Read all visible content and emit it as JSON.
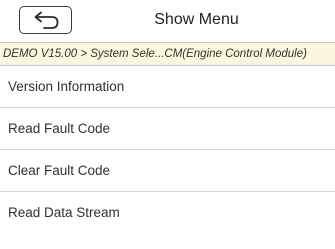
{
  "header": {
    "back_icon": "back-arrow-icon",
    "title": "Show Menu"
  },
  "breadcrumb": {
    "text": "DEMO V15.00 > System Sele...CM(Engine Control Module)"
  },
  "menu": {
    "items": [
      {
        "label": "Version Information"
      },
      {
        "label": "Read Fault Code"
      },
      {
        "label": "Clear Fault Code"
      },
      {
        "label": "Read Data Stream"
      }
    ]
  },
  "colors": {
    "breadcrumb_bg": "#fbf6de",
    "divider": "#d7d7d7",
    "text": "#303030"
  }
}
